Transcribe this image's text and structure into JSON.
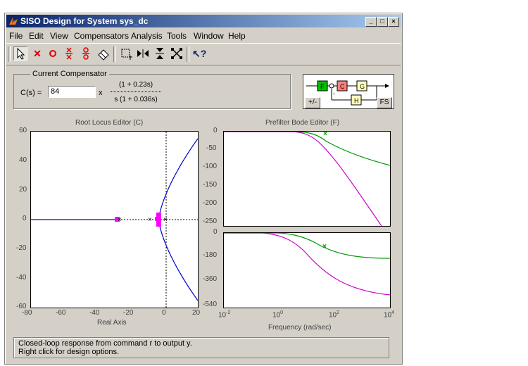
{
  "window": {
    "title": "SISO Design for System sys_dc"
  },
  "menu": [
    "File",
    "Edit",
    "View",
    "Compensators",
    "Analysis",
    "Tools",
    "Window",
    "Help"
  ],
  "compensator": {
    "legend": "Current Compensator",
    "label": "C(s) =",
    "gain": "84",
    "times": "x",
    "numerator": "(1 + 0.23s)",
    "denominator": "s (1 + 0.036s)"
  },
  "block_diagram": {
    "blocks": [
      "F",
      "C",
      "G",
      "H"
    ],
    "sign_label": "-",
    "signs_button": "+/-",
    "fs_button": "FS"
  },
  "root_locus": {
    "title": "Root Locus Editor (C)",
    "xlabel": "Real Axis",
    "xticks": [
      "-80",
      "-60",
      "-40",
      "-20",
      "0",
      "20"
    ],
    "yticks": [
      "60",
      "40",
      "20",
      "0",
      "-20",
      "-40",
      "-60"
    ]
  },
  "bode": {
    "title": "Prefilter Bode Editor (F)",
    "mag_yticks": [
      "0",
      "-50",
      "-100",
      "-150",
      "-200",
      "-250"
    ],
    "phase_yticks": [
      "0",
      "-180",
      "-360",
      "-540"
    ],
    "xticks": [
      "10",
      "10",
      "10",
      "10"
    ],
    "xtick_exponents": [
      "-2",
      "0",
      "2",
      "4"
    ],
    "xlabel": "Frequency (rad/sec)"
  },
  "status": {
    "line1": "Closed-loop response from command r to output y.",
    "line2": "Right click for design options."
  },
  "colors": {
    "titlebar_start": "#0a246a",
    "locus": "#0000cc",
    "pole_zero_marker": "#ff00ff",
    "prefilter_curve": "#009900",
    "closed_loop_curve": "#cc00cc"
  }
}
